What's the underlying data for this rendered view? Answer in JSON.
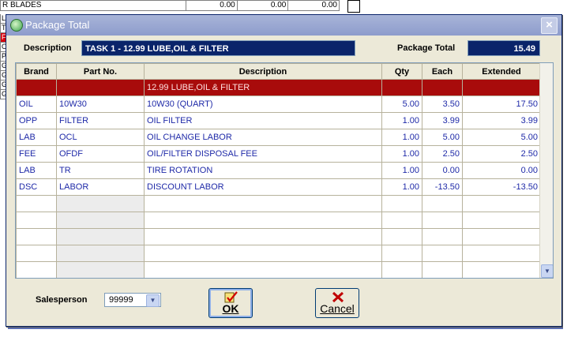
{
  "background": {
    "rows": [
      {
        "left": "R BLADES",
        "c1": "0.00",
        "c2": "0.00",
        "c3": "0.00"
      }
    ],
    "left_markers": [
      "LA",
      "TS",
      "F",
      "O",
      "P",
      "G",
      "G",
      "G",
      "G"
    ]
  },
  "dialog": {
    "title": "Package Total",
    "close_label": "×",
    "description_label": "Description",
    "description_value": "TASK  1 - 12.99 LUBE,OIL & FILTER",
    "package_total_label": "Package Total",
    "package_total_value": "15.49",
    "columns": [
      "Brand",
      "Part No.",
      "Description",
      "Qty",
      "Each",
      "Extended"
    ],
    "rows": [
      {
        "brand": "",
        "part": "",
        "desc": "12.99 LUBE,OIL & FILTER",
        "qty": "",
        "each": "",
        "ext": "",
        "selected": true
      },
      {
        "brand": "OIL",
        "part": "10W30",
        "desc": "10W30 (QUART)",
        "qty": "5.00",
        "each": "3.50",
        "ext": "17.50"
      },
      {
        "brand": "OPP",
        "part": "FILTER",
        "desc": "OIL FILTER",
        "qty": "1.00",
        "each": "3.99",
        "ext": "3.99"
      },
      {
        "brand": "LAB",
        "part": "OCL",
        "desc": "OIL CHANGE LABOR",
        "qty": "1.00",
        "each": "5.00",
        "ext": "5.00"
      },
      {
        "brand": "FEE",
        "part": "OFDF",
        "desc": "OIL/FILTER DISPOSAL FEE",
        "qty": "1.00",
        "each": "2.50",
        "ext": "2.50"
      },
      {
        "brand": "LAB",
        "part": "TR",
        "desc": "TIRE ROTATION",
        "qty": "1.00",
        "each": "0.00",
        "ext": "0.00"
      },
      {
        "brand": "DSC",
        "part": "LABOR",
        "desc": "DISCOUNT LABOR",
        "qty": "1.00",
        "each": "-13.50",
        "ext": "-13.50"
      }
    ],
    "empty_rows": 5,
    "salesperson_label": "Salesperson",
    "salesperson_value": "99999",
    "ok_label": "OK",
    "cancel_label": "Cancel"
  },
  "colors": {
    "title_bar": "#8e9ccc",
    "value_box": "#0a246a",
    "selected_row": "#a80b0b",
    "cell_text": "#1f2aa8"
  }
}
